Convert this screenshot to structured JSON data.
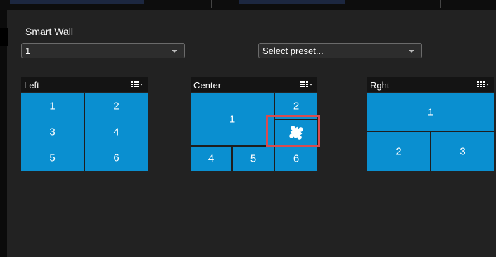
{
  "header": {
    "title": "Smart Wall"
  },
  "controls": {
    "wall_select": {
      "value": "1"
    },
    "preset_select": {
      "value": "Select preset..."
    }
  },
  "monitors": [
    {
      "name": "Left",
      "tiles": [
        "1",
        "2",
        "3",
        "4",
        "5",
        "6"
      ]
    },
    {
      "name": "Center",
      "tiles": [
        "1",
        "2",
        "4",
        "5",
        "6"
      ],
      "empty_slot_icon": "puzzle-piece-icon"
    },
    {
      "name": "Rght",
      "tiles": [
        "1",
        "2",
        "3"
      ]
    }
  ],
  "colors": {
    "tile": "#0a8fd0",
    "panel": "#222222",
    "highlight": "#d94b4f"
  }
}
